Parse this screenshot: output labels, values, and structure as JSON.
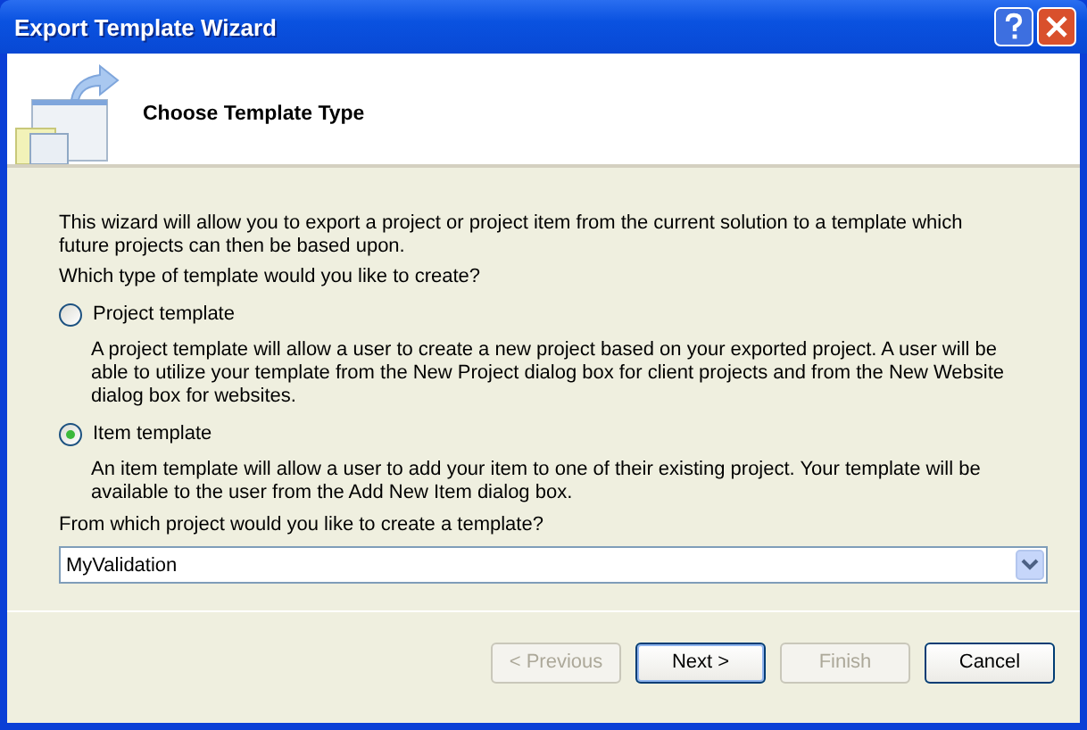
{
  "window": {
    "title": "Export Template Wizard"
  },
  "header": {
    "title": "Choose Template Type"
  },
  "intro": "This wizard will allow you to export a project or project item from the current solution to a template which future projects can then be based upon.",
  "question": "Which type of template would you like to create?",
  "template_types": [
    {
      "label": "Project template",
      "description": "A project template will allow a user to create a new project based on your exported project. A user will be able to utilize your template from the New Project dialog box for client projects and from the New Website dialog box for websites.",
      "selected": false
    },
    {
      "label": "Item template",
      "description": "An item template will allow a user to add your item to one of their existing project. Your template will be available to the user from the Add New Item dialog box.",
      "selected": true
    }
  ],
  "project_prompt": "From which project would you like to create a template?",
  "project_select": {
    "value": "MyValidation"
  },
  "buttons": [
    {
      "label": "< Previous",
      "disabled": true,
      "default": false
    },
    {
      "label": "Next >",
      "disabled": false,
      "default": true
    },
    {
      "label": "Finish",
      "disabled": true,
      "default": false
    },
    {
      "label": "Cancel",
      "disabled": false,
      "default": false
    }
  ]
}
